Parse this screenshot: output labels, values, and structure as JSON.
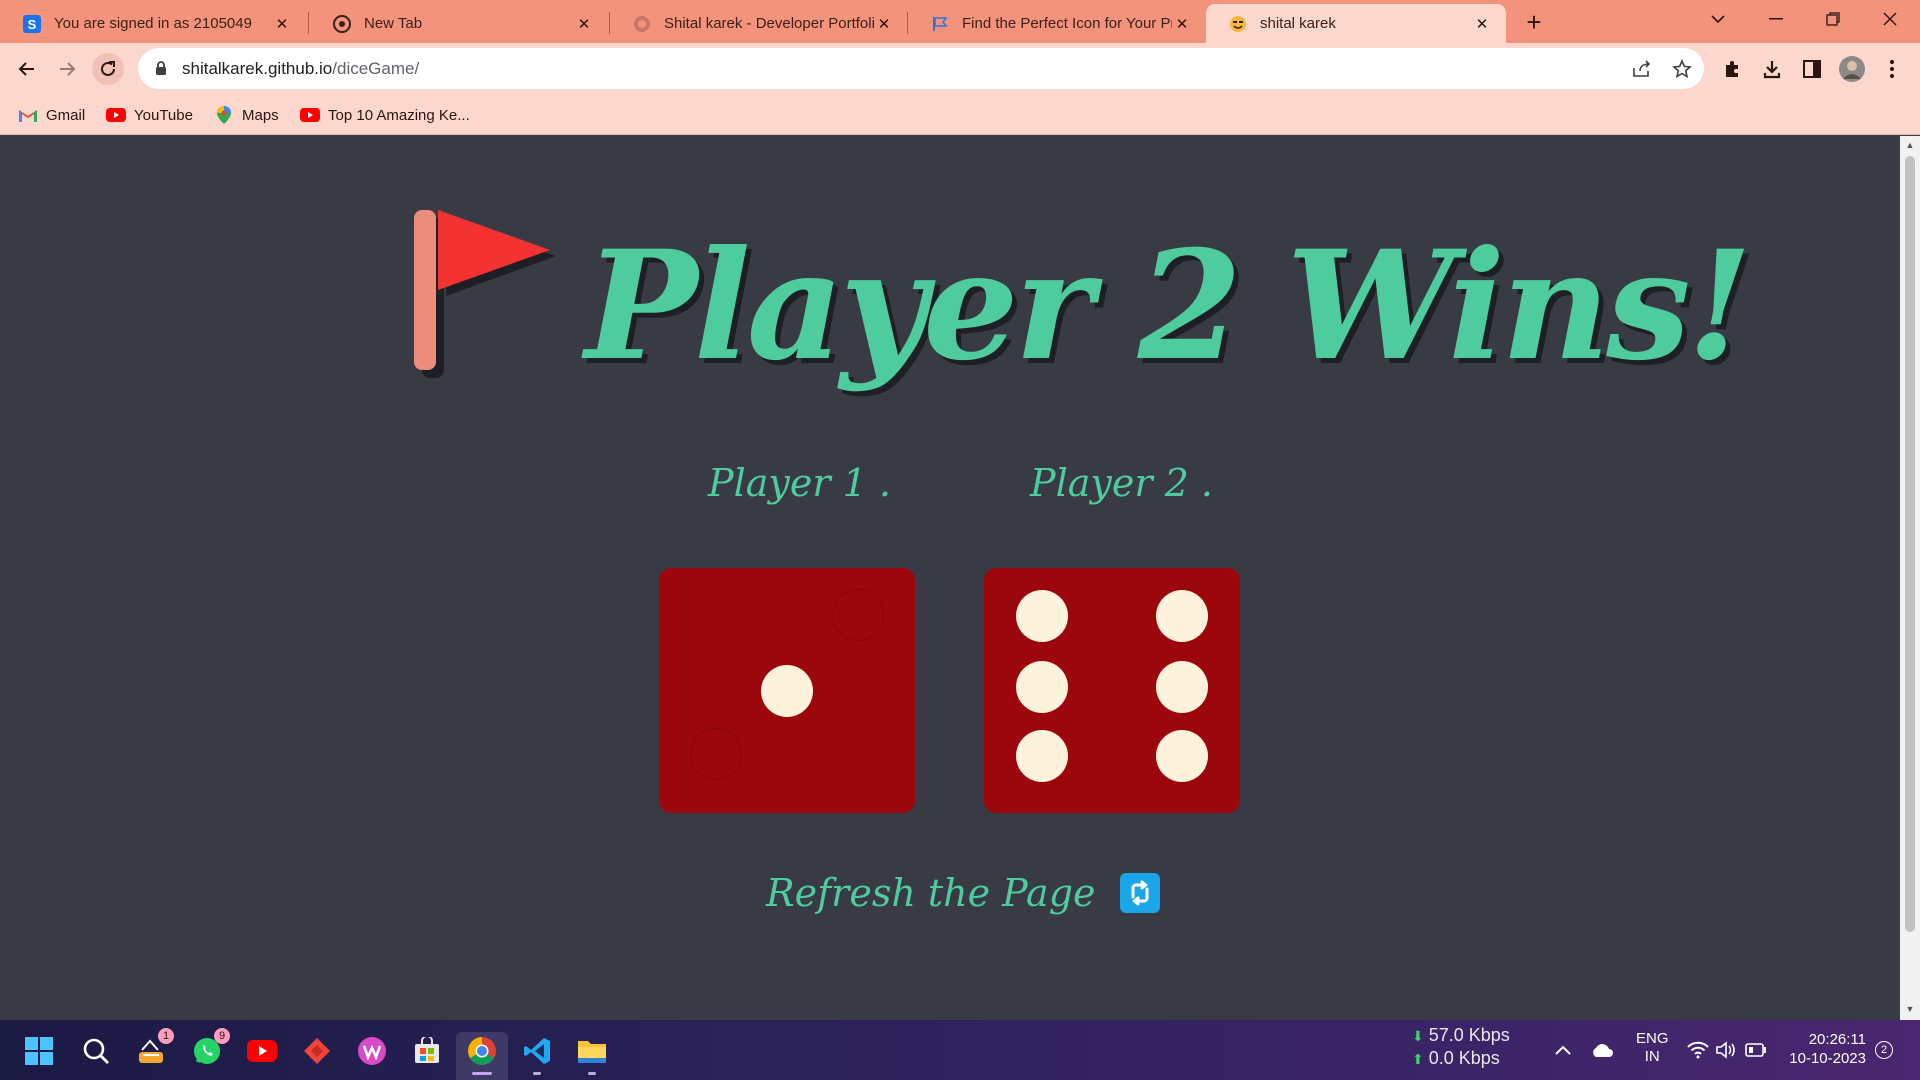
{
  "browser": {
    "tabs": [
      {
        "title": "You are signed in as 2105049",
        "icon": "s-brand-icon"
      },
      {
        "title": "New Tab",
        "icon": "chrome-icon"
      },
      {
        "title": "Shital karek - Developer Portfolio",
        "icon": "globe-icon"
      },
      {
        "title": "Find the Perfect Icon for Your Pr",
        "icon": "flag-favicon-icon"
      },
      {
        "title": "shital karek",
        "icon": "emoji-favicon-icon"
      }
    ],
    "active_tab": 4,
    "url_host": "shitalkarek.github.io",
    "url_path": "/diceGame/",
    "bookmarks": [
      {
        "label": "Gmail",
        "icon": "gmail-icon"
      },
      {
        "label": "YouTube",
        "icon": "youtube-icon"
      },
      {
        "label": "Maps",
        "icon": "maps-icon"
      },
      {
        "label": "Top 10 Amazing Ke...",
        "icon": "youtube-icon"
      }
    ]
  },
  "game": {
    "headline": "Player 2 Wins!",
    "player1_label": "Player 1 .",
    "player2_label": "Player 2 .",
    "player1_die_value": 1,
    "player2_die_value": 6,
    "refresh_label": "Refresh the Page",
    "colors": {
      "background": "#393b44",
      "accent": "#4ecc9e",
      "die": "#9b070c",
      "pip": "#fdf3dc",
      "flag": "#f53232",
      "refresh_button": "#1aa6e8"
    }
  },
  "taskbar": {
    "apps": [
      {
        "name": "windows-start-icon"
      },
      {
        "name": "search-icon"
      },
      {
        "name": "app-1-icon",
        "badge": "1"
      },
      {
        "name": "whatsapp-icon",
        "badge": "9"
      },
      {
        "name": "youtube-icon"
      },
      {
        "name": "anydesk-icon"
      },
      {
        "name": "wps-office-icon"
      },
      {
        "name": "microsoft-store-icon"
      },
      {
        "name": "chrome-icon"
      },
      {
        "name": "vscode-icon"
      },
      {
        "name": "file-explorer-icon"
      }
    ],
    "net_down": "57.0 Kbps",
    "net_up": "0.0 Kbps",
    "lang_line1": "ENG",
    "lang_line2": "IN",
    "time": "20:26:11",
    "date": "10-10-2023",
    "notification_count": "2"
  }
}
